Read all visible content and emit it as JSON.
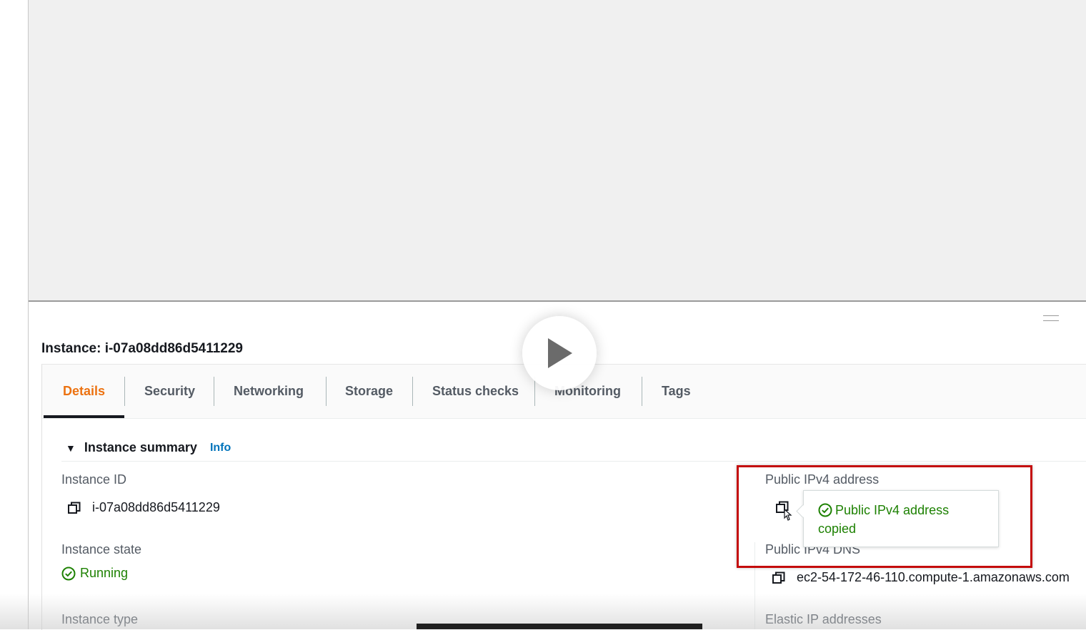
{
  "panel": {
    "title": "Instance: i-07a08dd86d5411229"
  },
  "tabs": [
    {
      "label": "Details"
    },
    {
      "label": "Security"
    },
    {
      "label": "Networking"
    },
    {
      "label": "Storage"
    },
    {
      "label": "Status checks"
    },
    {
      "label": "Monitoring"
    },
    {
      "label": "Tags"
    }
  ],
  "active_tab": "Details",
  "summary": {
    "title": "Instance summary",
    "info_label": "Info"
  },
  "fields": {
    "instance_id_label": "Instance ID",
    "instance_id_value": "i-07a08dd86d5411229",
    "instance_state_label": "Instance state",
    "instance_state_value": "Running",
    "instance_type_label": "Instance type",
    "public_ipv4_label": "Public IPv4 address",
    "public_ipv4_dns_label": "Public IPv4 DNS",
    "public_ipv4_dns_value": "ec2-54-172-46-110.compute-1.amazonaws.com",
    "elastic_ip_label": "Elastic IP addresses"
  },
  "popover": {
    "message": "Public IPv4 address copied"
  },
  "icons": {
    "copy": "copy-icon",
    "check": "check-circle-icon",
    "caret": "caret-down-icon",
    "play": "play-icon",
    "cursor": "hand-pointer-icon"
  },
  "colors": {
    "active_tab": "#ec7211",
    "success": "#1d8102",
    "link": "#0073bb",
    "highlight": "#c40b0b"
  }
}
